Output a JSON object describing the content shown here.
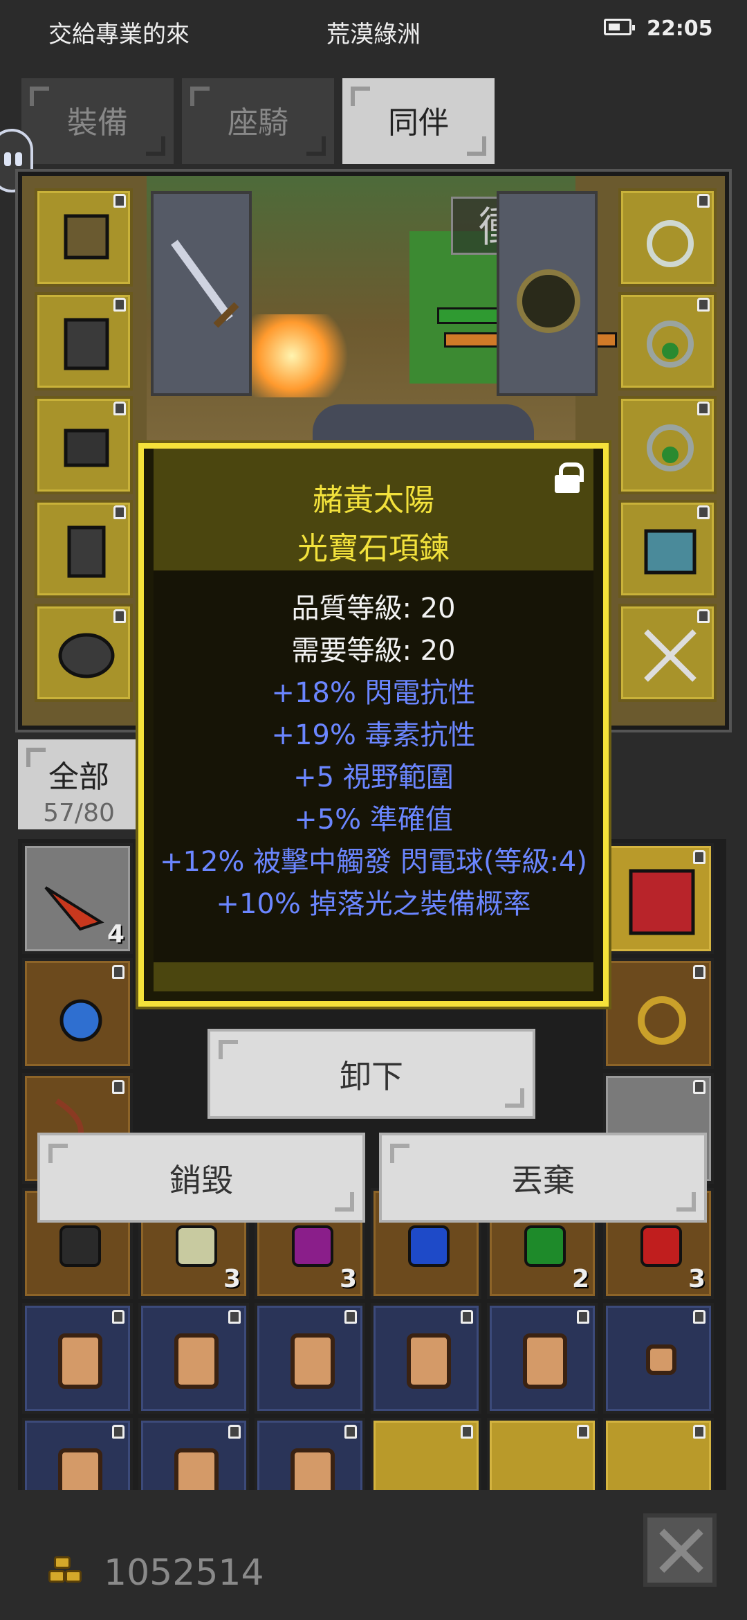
{
  "status_bar": {
    "left_text": "交給專業的來",
    "center_text": "荒漠綠洲",
    "time": "22:05",
    "battery_icon": "battery-icon"
  },
  "tabs": [
    {
      "label": "裝備",
      "active": false
    },
    {
      "label": "座騎",
      "active": false
    },
    {
      "label": "同伴",
      "active": true
    }
  ],
  "scene": {
    "combat_text": "衝鋒"
  },
  "filter": {
    "label": "全部",
    "count": "57/80"
  },
  "item_popup": {
    "name_line1": "赭黃太陽",
    "name_line2": "光寶石項鍊",
    "stats": [
      {
        "text": "品質等級: 20",
        "color": "white"
      },
      {
        "text": "需要等級: 20",
        "color": "white"
      },
      {
        "text": "+18% 閃電抗性",
        "color": "blue"
      },
      {
        "text": "+19% 毒素抗性",
        "color": "blue"
      },
      {
        "text": "+5 視野範圍",
        "color": "blue"
      },
      {
        "text": "+5% 準確值",
        "color": "blue"
      },
      {
        "text": "+12% 被擊中觸發 閃電球(等級:4)",
        "color": "blue"
      },
      {
        "text": "+10% 掉落光之裝備概率",
        "color": "blue"
      }
    ]
  },
  "actions": {
    "unequip": "卸下",
    "destroy": "銷毀",
    "discard": "丟棄"
  },
  "inventory": {
    "quantities": {
      "first_item": "4",
      "gem2": "3",
      "gem3": "3",
      "gem5": "2",
      "gem6": "3"
    }
  },
  "footer": {
    "gold": "1052514"
  },
  "colors": {
    "popup_border": "#f5e23a",
    "popup_title": "#f3e23c",
    "stat_blue": "#6b86ff"
  }
}
